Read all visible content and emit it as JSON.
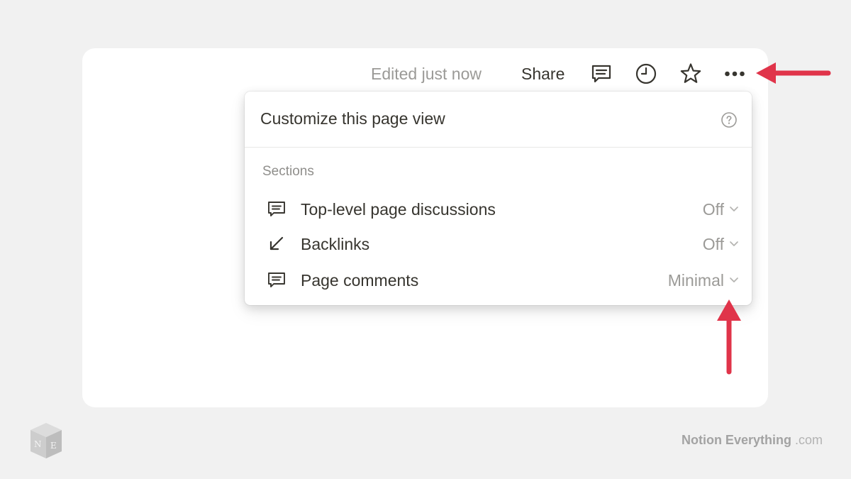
{
  "topbar": {
    "edited_label": "Edited just now",
    "share_label": "Share",
    "icons": [
      "comment-icon",
      "clock-icon",
      "star-icon",
      "more-icon"
    ]
  },
  "popup": {
    "title": "Customize this page view",
    "help_icon": "help-icon",
    "section_label": "Sections",
    "rows": [
      {
        "icon": "comment-icon",
        "label": "Top-level page discussions",
        "value": "Off"
      },
      {
        "icon": "backlink-arrow-icon",
        "label": "Backlinks",
        "value": "Off"
      },
      {
        "icon": "comment-icon",
        "label": "Page comments",
        "value": "Minimal"
      }
    ]
  },
  "annotations": {
    "color": "#e0344a"
  },
  "footer": {
    "logo_letters": "N E",
    "brand": "Notion Everything",
    "domain": ".com"
  }
}
